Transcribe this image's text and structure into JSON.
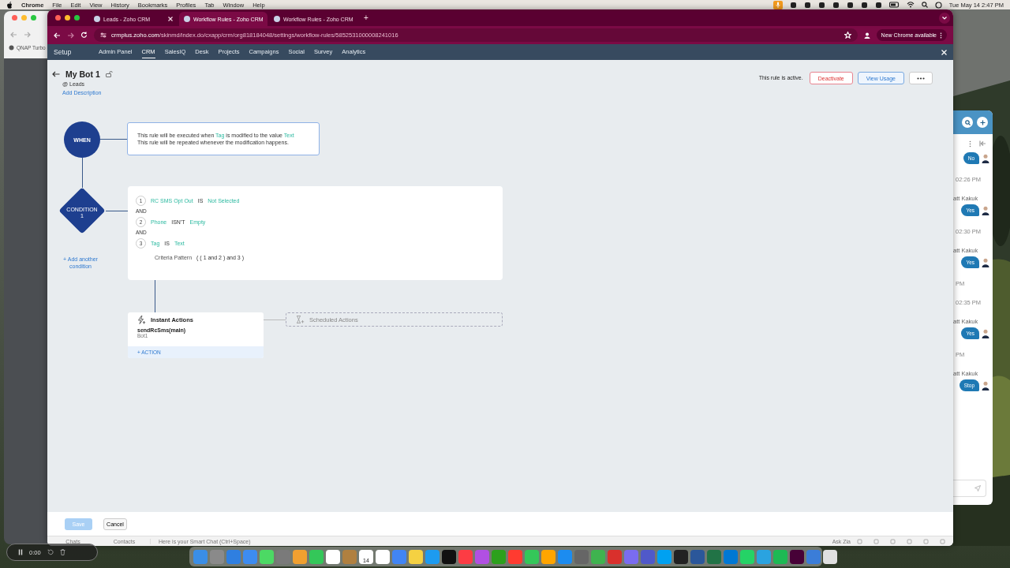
{
  "menu_bar": {
    "app": "Chrome",
    "items": [
      "File",
      "Edit",
      "View",
      "History",
      "Bookmarks",
      "Profiles",
      "Tab",
      "Window",
      "Help"
    ],
    "clock": "Tue May 14  2:47 PM"
  },
  "back_window": {
    "bookmark": "QNAP Turbo"
  },
  "browser": {
    "tabs": [
      {
        "title": "Leads - Zoho CRM",
        "selected": false
      },
      {
        "title": "Workflow Rules - Zoho CRM",
        "selected": true
      },
      {
        "title": "Workflow Rules - Zoho CRM",
        "selected": false
      }
    ],
    "new_tab": "+",
    "url_host": "crmplus.zoho.com",
    "url_path": "/skinmd/index.do/cxapp/crm/org818184048/settings/workflow-rules/5852531000008241016",
    "update_button": "New Chrome available"
  },
  "nav": {
    "title": "Setup",
    "items": [
      {
        "label": "Admin Panel",
        "selected": false
      },
      {
        "label": "CRM",
        "selected": true
      },
      {
        "label": "SalesIQ",
        "selected": false
      },
      {
        "label": "Desk",
        "selected": false
      },
      {
        "label": "Projects",
        "selected": false
      },
      {
        "label": "Campaigns",
        "selected": false
      },
      {
        "label": "Social",
        "selected": false
      },
      {
        "label": "Survey",
        "selected": false
      },
      {
        "label": "Analytics",
        "selected": false
      }
    ]
  },
  "rule": {
    "name": "My Bot 1",
    "module": "@ Leads",
    "add_description": "Add Description",
    "status": "This rule is active.",
    "deactivate": "Deactivate",
    "view_usage": "View Usage"
  },
  "when": {
    "label": "WHEN",
    "lines": [
      [
        {
          "text": "This rule will be executed when ",
          "kind": "plain"
        },
        {
          "text": "Tag",
          "kind": "field"
        },
        {
          "text": " is modified to the value ",
          "kind": "plain"
        },
        {
          "text": "Text",
          "kind": "field"
        }
      ],
      [
        {
          "text": "This rule will be repeated whenever the modification happens.",
          "kind": "plain"
        }
      ]
    ]
  },
  "condition": {
    "label": "CONDITION",
    "number": "1",
    "add_another": "+ Add another condition",
    "rows": [
      {
        "number": "1",
        "field": "RC SMS Opt Out",
        "operator": "IS",
        "value": "Not Selected"
      },
      {
        "number": "2",
        "field": "Phone",
        "operator": "ISN'T",
        "value": "Empty"
      },
      {
        "number": "3",
        "field": "Tag",
        "operator": "IS",
        "value": "Text"
      }
    ],
    "joiners": [
      "AND",
      "AND"
    ],
    "criteria_label": "Criteria Pattern",
    "criteria": "( ( 1 and 2 ) and 3 )"
  },
  "instant_actions": {
    "title": "Instant Actions",
    "actions": [
      {
        "name": "sendRcSms(main)",
        "detail": "Bot1"
      }
    ],
    "add": "+ ACTION"
  },
  "scheduled_actions": {
    "title": "Scheduled Actions"
  },
  "footer": {
    "save": {
      "label": "Save",
      "disabled": true
    },
    "cancel": "Cancel"
  },
  "bottom_bar": {
    "chats": "Chats",
    "contacts": "Contacts",
    "hint": "Here is your Smart Chat (Ctrl+Space)",
    "zia": "Ask Zia"
  },
  "chat_panel": {
    "messages": [
      {
        "kind": "bubble",
        "text": "No"
      },
      {
        "kind": "time",
        "text": "02:26 PM"
      },
      {
        "kind": "sender",
        "text": "att Kakuk"
      },
      {
        "kind": "bubble",
        "text": "Yes"
      },
      {
        "kind": "time",
        "text": "02:30 PM"
      },
      {
        "kind": "sender",
        "text": "att Kakuk"
      },
      {
        "kind": "bubble",
        "text": "Yes"
      },
      {
        "kind": "time",
        "text": "PM"
      },
      {
        "kind": "time",
        "text": "02:35 PM"
      },
      {
        "kind": "sender",
        "text": "att Kakuk"
      },
      {
        "kind": "bubble",
        "text": "Yes"
      },
      {
        "kind": "time",
        "text": "PM"
      },
      {
        "kind": "sender",
        "text": "att Kakuk"
      },
      {
        "kind": "bubble",
        "text": "Stop"
      }
    ]
  },
  "recorder": {
    "time": "0:00"
  },
  "dock": {
    "calendar_day": "14"
  }
}
